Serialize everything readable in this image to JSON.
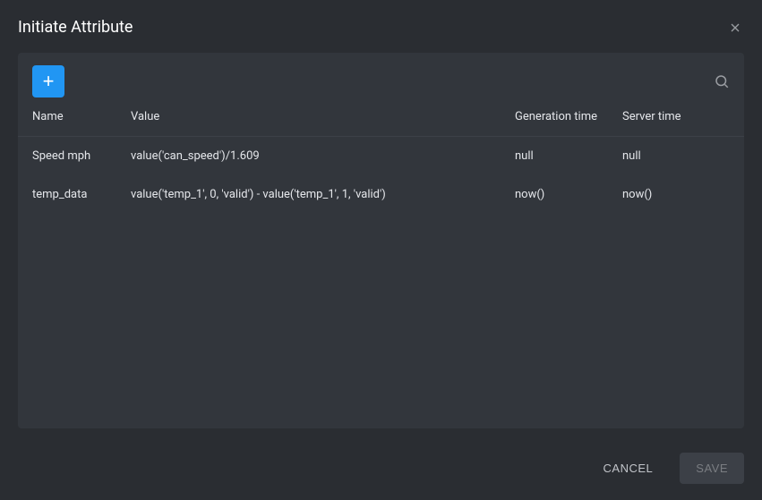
{
  "dialog": {
    "title": "Initiate Attribute"
  },
  "toolbar": {
    "add_label": "+"
  },
  "table": {
    "headers": {
      "name": "Name",
      "value": "Value",
      "generation_time": "Generation time",
      "server_time": "Server time"
    },
    "rows": [
      {
        "name": "Speed mph",
        "value": "value('can_speed')/1.609",
        "generation_time": "null",
        "server_time": "null"
      },
      {
        "name": "temp_data",
        "value": "value('temp_1', 0, 'valid') - value('temp_1', 1, 'valid')",
        "generation_time": "now()",
        "server_time": "now()"
      }
    ]
  },
  "footer": {
    "cancel_label": "CANCEL",
    "save_label": "SAVE"
  }
}
